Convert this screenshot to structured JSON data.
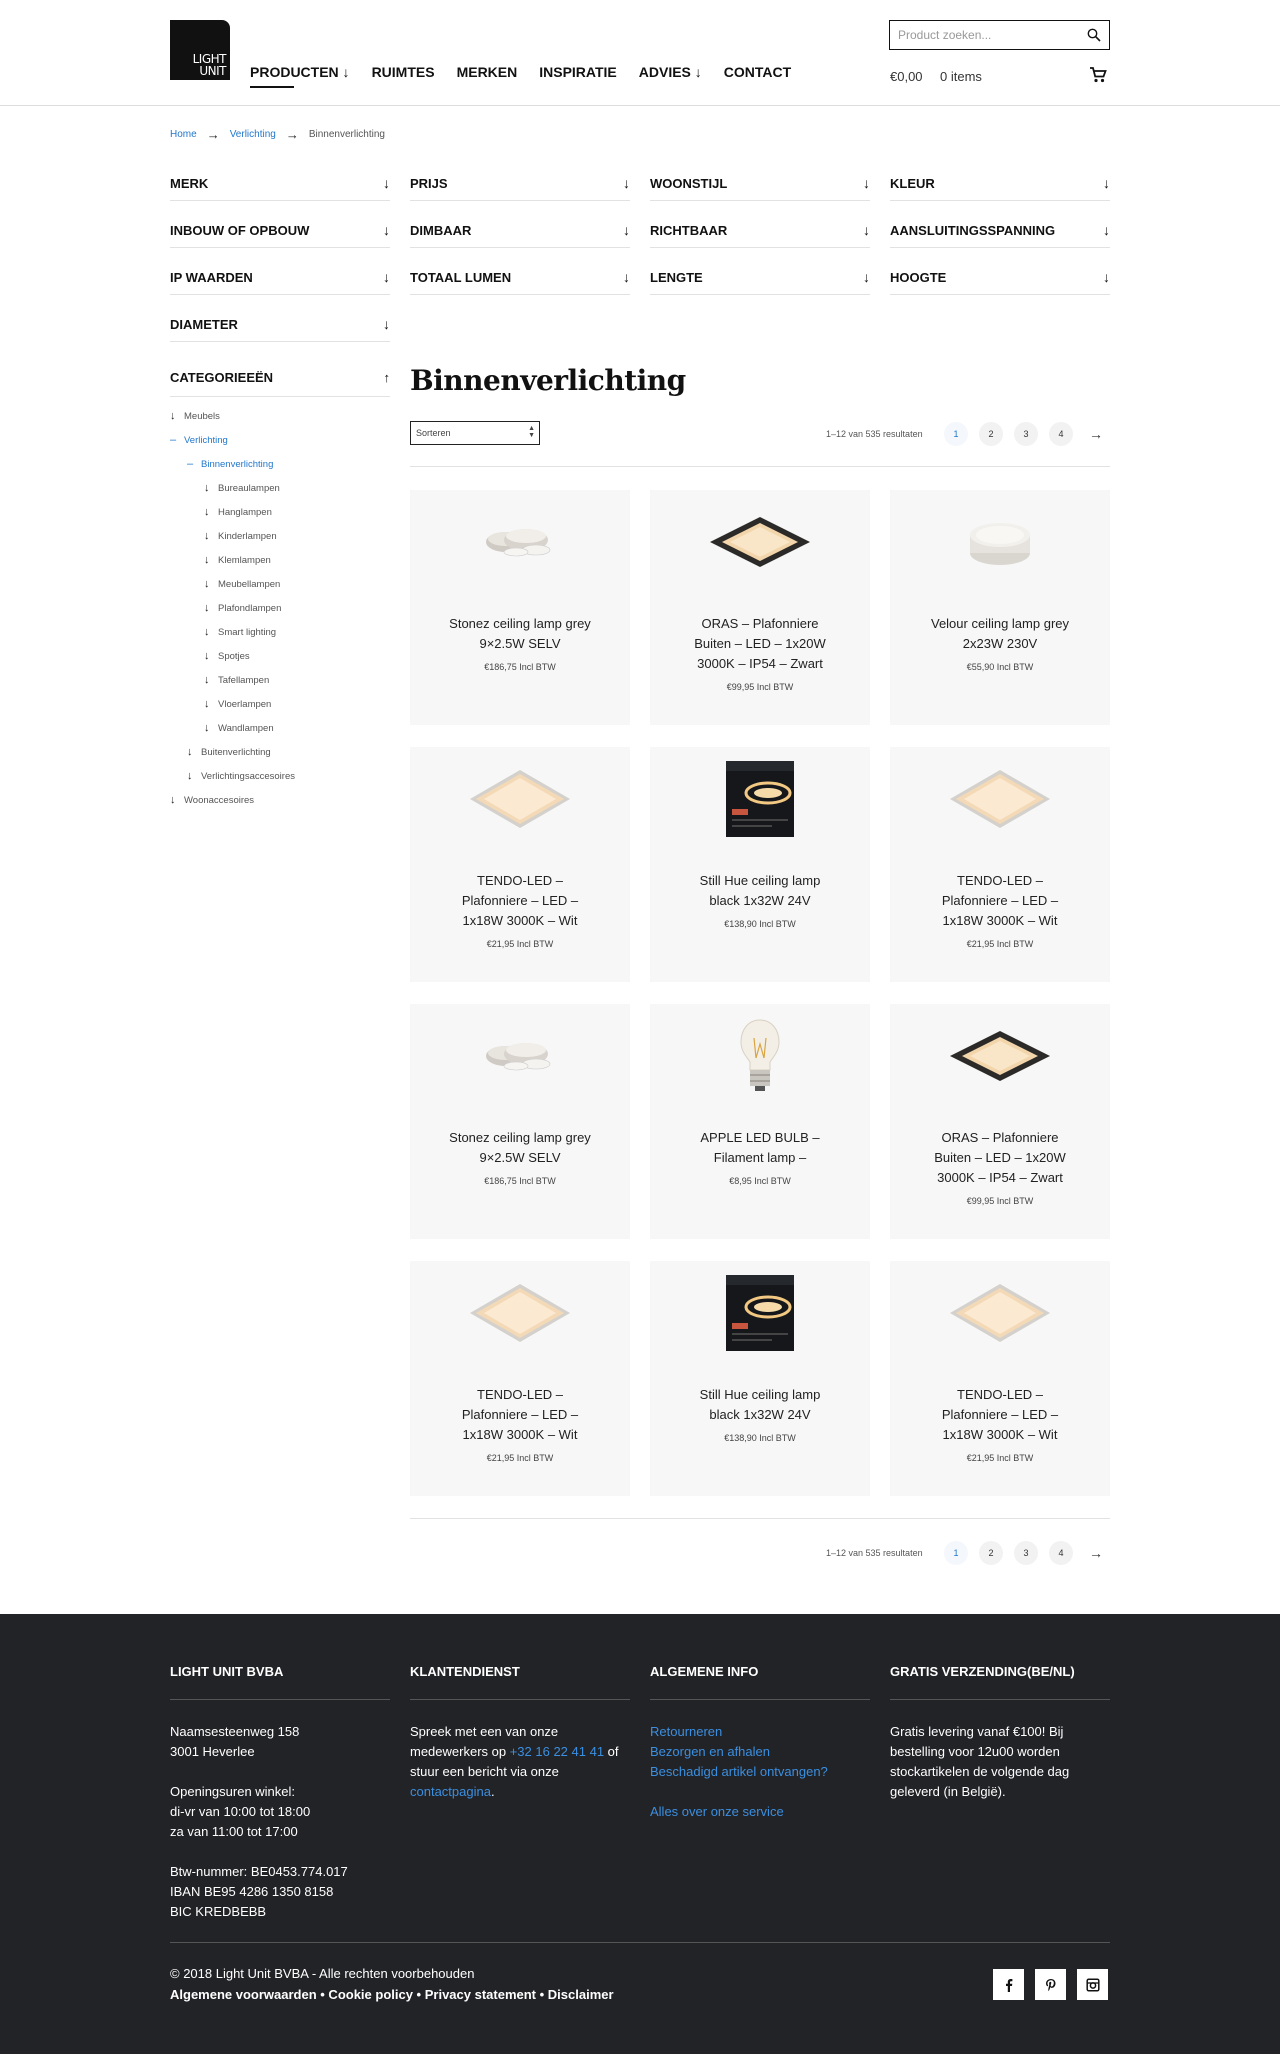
{
  "header": {
    "logo_text": "LIGHT UNIT",
    "nav": [
      "PRODUCTEN ↓",
      "RUIMTES",
      "MERKEN",
      "INSPIRATIE",
      "ADVIES ↓",
      "CONTACT"
    ],
    "search_placeholder": "Product zoeken...",
    "cart_price": "€0,00",
    "cart_items": "0 items"
  },
  "breadcrumb": {
    "home": "Home",
    "parent": "Verlichting",
    "current": "Binnenverlichting"
  },
  "filters": [
    "MERK",
    "PRIJS",
    "WOONSTIJL",
    "KLEUR",
    "INBOUW OF OPBOUW",
    "DIMBAAR",
    "RICHTBAAR",
    "AANSLUITINGSSPANNING",
    "IP WAARDEN",
    "TOTAAL LUMEN",
    "LENGTE",
    "HOOGTE",
    "DIAMETER"
  ],
  "categories": {
    "heading": "CATEGORIEEËN",
    "items": [
      {
        "label": "Meubels",
        "level": 0,
        "icon": "↓"
      },
      {
        "label": "Verlichting",
        "level": 0,
        "icon": "–",
        "active": true
      },
      {
        "label": "Binnenverlichting",
        "level": 1,
        "icon": "–",
        "active": true
      },
      {
        "label": "Bureaulampen",
        "level": 2,
        "icon": "↓"
      },
      {
        "label": "Hanglampen",
        "level": 2,
        "icon": "↓"
      },
      {
        "label": "Kinderlampen",
        "level": 2,
        "icon": "↓"
      },
      {
        "label": "Klemlampen",
        "level": 2,
        "icon": "↓"
      },
      {
        "label": "Meubellampen",
        "level": 2,
        "icon": "↓"
      },
      {
        "label": "Plafondlampen",
        "level": 2,
        "icon": "↓"
      },
      {
        "label": "Smart lighting",
        "level": 2,
        "icon": "↓"
      },
      {
        "label": "Spotjes",
        "level": 2,
        "icon": "↓"
      },
      {
        "label": "Tafellampen",
        "level": 2,
        "icon": "↓"
      },
      {
        "label": "Vloerlampen",
        "level": 2,
        "icon": "↓"
      },
      {
        "label": "Wandlampen",
        "level": 2,
        "icon": "↓"
      },
      {
        "label": "Buitenverlichting",
        "level": 1,
        "icon": "↓"
      },
      {
        "label": "Verlichtingsaccesoires",
        "level": 1,
        "icon": "↓"
      },
      {
        "label": "Woonaccesoires",
        "level": 0,
        "icon": "↓"
      }
    ]
  },
  "main": {
    "title": "Binnenverlichting",
    "sort_label": "Sorteren",
    "results": "1–12 van 535 resultaten",
    "pages": [
      "1",
      "2",
      "3",
      "4"
    ],
    "next": "→"
  },
  "products": [
    {
      "name": "Stonez ceiling lamp grey 9×2.5W SELV",
      "price": "€186,75 Incl BTW",
      "image": "stonez"
    },
    {
      "name": "ORAS – Plafonniere Buiten – LED – 1x20W 3000K – IP54 – Zwart",
      "price": "€99,95 Incl BTW",
      "image": "oras"
    },
    {
      "name": "Velour ceiling lamp grey 2x23W 230V",
      "price": "€55,90 Incl BTW",
      "image": "velour"
    },
    {
      "name": "TENDO-LED – Plafonniere – LED – 1x18W 3000K – Wit",
      "price": "€21,95 Incl BTW",
      "image": "tendo"
    },
    {
      "name": "Still Hue ceiling lamp black 1x32W 24V",
      "price": "€138,90 Incl BTW",
      "image": "hue"
    },
    {
      "name": "TENDO-LED – Plafonniere – LED – 1x18W 3000K – Wit",
      "price": "€21,95 Incl BTW",
      "image": "tendo"
    },
    {
      "name": "Stonez ceiling lamp grey 9×2.5W SELV",
      "price": "€186,75 Incl BTW",
      "image": "stonez"
    },
    {
      "name": "APPLE LED BULB – Filament lamp –",
      "price": "€8,95 Incl BTW",
      "image": "bulb"
    },
    {
      "name": "ORAS – Plafonniere Buiten – LED – 1x20W 3000K – IP54 – Zwart",
      "price": "€99,95 Incl BTW",
      "image": "oras"
    },
    {
      "name": "TENDO-LED – Plafonniere – LED – 1x18W 3000K – Wit",
      "price": "€21,95 Incl BTW",
      "image": "tendo"
    },
    {
      "name": "Still Hue ceiling lamp black 1x32W 24V",
      "price": "€138,90 Incl BTW",
      "image": "hue"
    },
    {
      "name": "TENDO-LED – Plafonniere – LED – 1x18W 3000K – Wit",
      "price": "€21,95 Incl BTW",
      "image": "tendo"
    }
  ],
  "footer": {
    "col1": {
      "heading": "LIGHT UNIT BVBA",
      "lines": [
        "Naamsesteenweg 158",
        "3001 Heverlee",
        "",
        "Openingsuren winkel:",
        "di-vr van 10:00 tot 18:00",
        "za van 11:00 tot 17:00",
        "",
        "Btw-nummer: BE0453.774.017",
        "IBAN BE95 4286 1350 8158",
        "BIC KREDBEBB"
      ]
    },
    "col2": {
      "heading": "KLANTENDIENST",
      "text1": "Spreek met een van onze medewerkers op ",
      "phone": "+32 16 22 41 41",
      "text2": " of stuur een bericht via onze ",
      "link": "contactpagina",
      "text3": "."
    },
    "col3": {
      "heading": "ALGEMENE INFO",
      "links": [
        "Retourneren",
        "Bezorgen en afhalen",
        "Beschadigd artikel ontvangen?"
      ],
      "service": "Alles over onze service"
    },
    "col4": {
      "heading": "GRATIS VERZENDING(BE/NL)",
      "text": "Gratis levering vanaf €100! Bij bestelling voor 12u00 worden stockartikelen de volgende dag geleverd (in België)."
    },
    "copyright": "© 2018 Light Unit BVBA - Alle rechten voorbehouden",
    "legal": "Algemene voorwaarden • Cookie policy • Privacy statement • Disclaimer",
    "social": [
      "facebook-icon",
      "pinterest-icon",
      "instagram-icon"
    ]
  },
  "colors": {
    "link": "#2277cc",
    "footer_bg": "#222327",
    "footer_link": "#3b8fe0"
  }
}
